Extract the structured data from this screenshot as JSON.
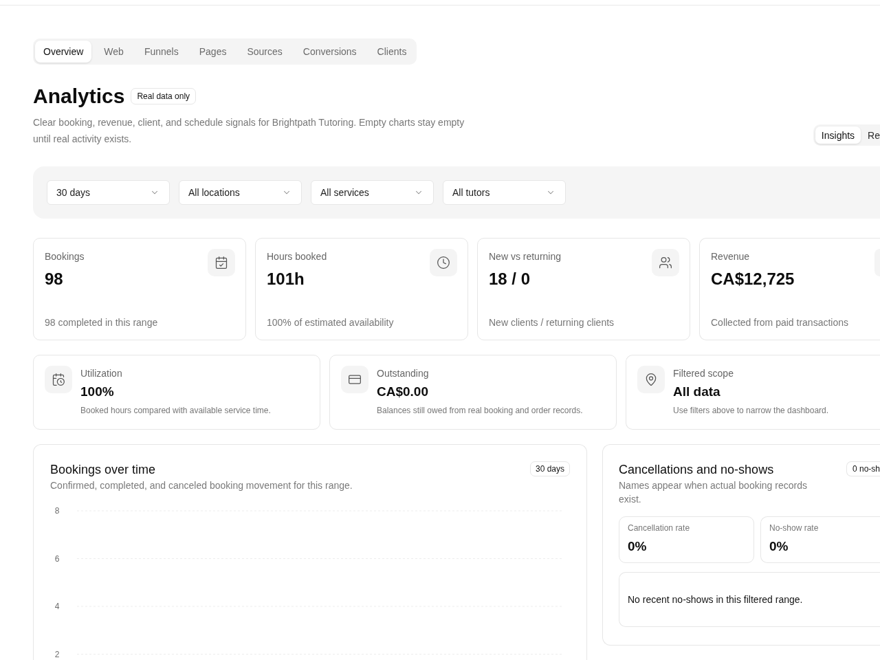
{
  "tabs": [
    {
      "label": "Overview",
      "selected": true
    },
    {
      "label": "Web",
      "selected": false
    },
    {
      "label": "Funnels",
      "selected": false
    },
    {
      "label": "Pages",
      "selected": false
    },
    {
      "label": "Sources",
      "selected": false
    },
    {
      "label": "Conversions",
      "selected": false
    },
    {
      "label": "Clients",
      "selected": false
    }
  ],
  "header": {
    "title": "Analytics",
    "badge": "Real data only",
    "description": "Clear booking, revenue, client, and schedule signals for Brightpath Tutoring. Empty charts stay empty until real activity exists."
  },
  "view_toggle": [
    {
      "label": "Insights",
      "selected": true
    },
    {
      "label": "Re",
      "selected": false
    }
  ],
  "filters": [
    {
      "value": "30 days"
    },
    {
      "value": "All locations"
    },
    {
      "value": "All services"
    },
    {
      "value": "All tutors"
    }
  ],
  "kpis": [
    {
      "label": "Bookings",
      "value": "98",
      "note": "98 completed in this range"
    },
    {
      "label": "Hours booked",
      "value": "101h",
      "note": "100% of estimated availability"
    },
    {
      "label": "New vs returning",
      "value": "18 / 0",
      "note": "New clients / returning clients"
    },
    {
      "label": "Revenue",
      "value": "CA$12,725",
      "note": "Collected from paid transactions"
    }
  ],
  "summary_cards": [
    {
      "label": "Utilization",
      "value": "100%",
      "note": "Booked hours compared with available service time."
    },
    {
      "label": "Outstanding",
      "value": "CA$0.00",
      "note": "Balances still owed from real booking and order records."
    },
    {
      "label": "Filtered scope",
      "value": "All data",
      "note": "Use filters above to narrow the dashboard."
    }
  ],
  "bookings_chart": {
    "title": "Bookings over time",
    "subtitle": "Confirmed, completed, and canceled booking movement for this range.",
    "badge": "30 days",
    "axis_labels": [
      "8",
      "6",
      "4",
      "2"
    ]
  },
  "cancellations": {
    "title": "Cancellations and no-shows",
    "subtitle": "Names appear when actual booking records exist.",
    "badge": "0 no-sh",
    "rates": [
      {
        "label": "Cancellation rate",
        "value": "0%"
      },
      {
        "label": "No-show rate",
        "value": "0%"
      }
    ],
    "empty_message": "No recent no-shows in this filtered range."
  }
}
